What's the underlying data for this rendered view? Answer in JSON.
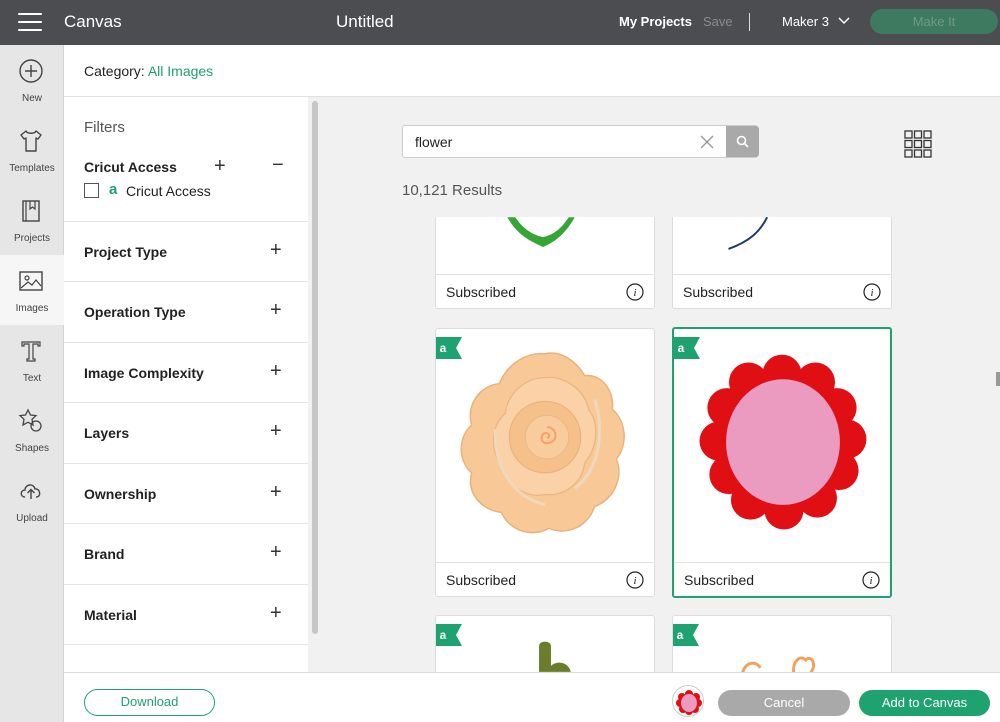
{
  "topbar": {
    "app_title": "Canvas",
    "doc_title": "Untitled",
    "my_projects": "My Projects",
    "save": "Save",
    "machine": "Maker 3",
    "make_it": "Make It"
  },
  "rail": {
    "items": [
      {
        "label": "New",
        "icon": "plus-circle-icon"
      },
      {
        "label": "Templates",
        "icon": "tshirt-icon"
      },
      {
        "label": "Projects",
        "icon": "book-icon"
      },
      {
        "label": "Images",
        "icon": "image-icon",
        "active": true
      },
      {
        "label": "Text",
        "icon": "text-t-icon"
      },
      {
        "label": "Shapes",
        "icon": "shapes-icon"
      },
      {
        "label": "Upload",
        "icon": "upload-cloud-icon"
      }
    ]
  },
  "category": {
    "label": "Category:",
    "value": "All Images"
  },
  "filters": {
    "title": "Filters",
    "access_title": "Cricut Access",
    "access_plus": "+",
    "access_minus": "−",
    "access_badge": "a",
    "access_checkbox_label": "Cricut Access",
    "sections": [
      "Project Type",
      "Operation Type",
      "Image Complexity",
      "Layers",
      "Ownership",
      "Brand",
      "Material"
    ],
    "plus": "+"
  },
  "search": {
    "value": "flower",
    "placeholder": "Search",
    "results_count": "10,121 Results"
  },
  "cards": [
    {
      "status": "Subscribed",
      "image": "green-leaf-partial"
    },
    {
      "status": "Subscribed",
      "image": "navy-line-partial"
    },
    {
      "status": "Subscribed",
      "image": "peach-rose",
      "badge": "a"
    },
    {
      "status": "Subscribed",
      "image": "red-pink-flower",
      "badge": "a",
      "selected": true
    },
    {
      "status": "",
      "image": "green-stem-partial",
      "badge": "a"
    },
    {
      "status": "",
      "image": "orange-flower-partial",
      "badge": "a"
    }
  ],
  "bottom": {
    "download": "Download",
    "cancel": "Cancel",
    "add": "Add to Canvas"
  },
  "colors": {
    "topbar": "#4b4d50",
    "accent": "#1ea26f",
    "selected_border": "#1ea26f",
    "flower_red": "#e00f14",
    "flower_pink": "#ec9bc0",
    "rose_peach": "#f8c996"
  }
}
